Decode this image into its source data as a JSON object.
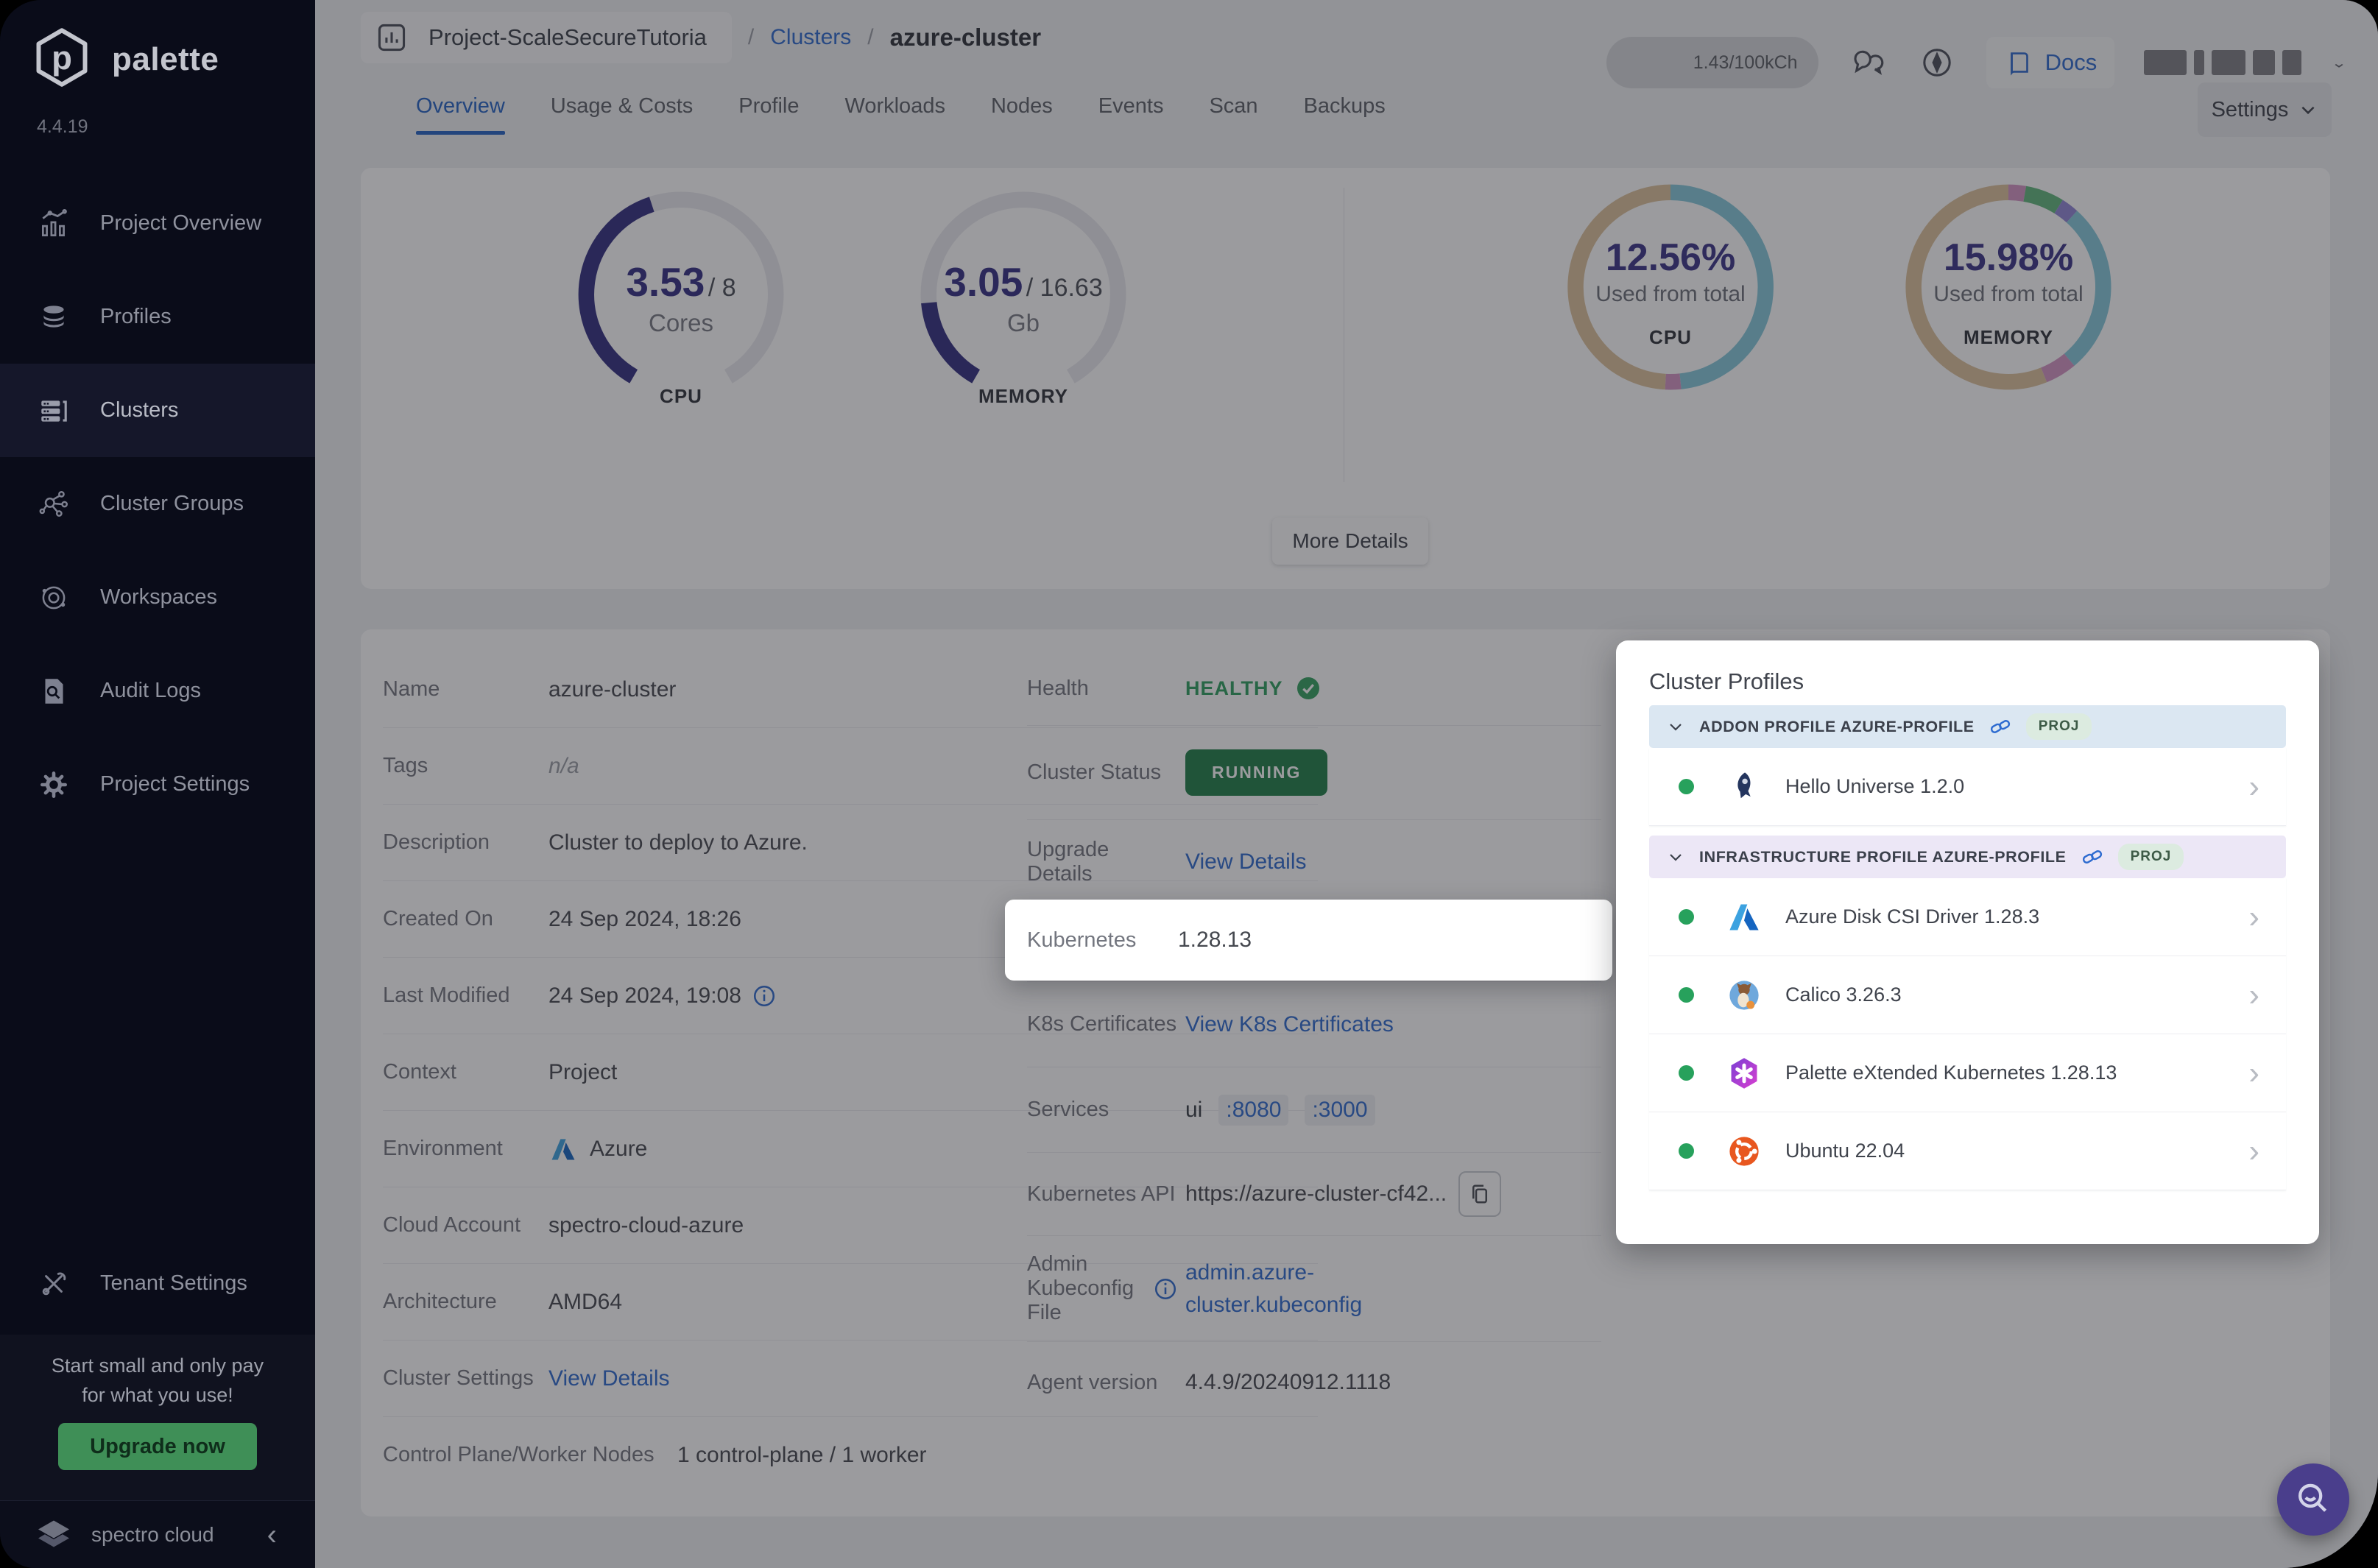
{
  "sidebar": {
    "brand": "palette",
    "version": "4.4.19",
    "items": [
      {
        "label": "Project Overview"
      },
      {
        "label": "Profiles"
      },
      {
        "label": "Clusters"
      },
      {
        "label": "Cluster Groups"
      },
      {
        "label": "Workspaces"
      },
      {
        "label": "Audit Logs"
      },
      {
        "label": "Project Settings"
      }
    ],
    "tenant_settings": "Tenant Settings",
    "banner": {
      "line1": "Start small and only pay",
      "line2": "for what you use!",
      "cta": "Upgrade now"
    },
    "footer": {
      "brand": "spectro cloud",
      "collapse_icon": "‹"
    }
  },
  "header": {
    "breadcrumb": {
      "project": "Project-ScaleSecureTutoria",
      "sep": "/",
      "section": "Clusters",
      "current": "azure-cluster"
    },
    "usage_pill": "1.43/100kCh",
    "docs": "Docs"
  },
  "tabs": {
    "items": [
      "Overview",
      "Usage & Costs",
      "Profile",
      "Workloads",
      "Nodes",
      "Events",
      "Scan",
      "Backups"
    ]
  },
  "settings_button": "Settings",
  "stats": {
    "cpu_gauge": {
      "value": "3.53",
      "sep": "/",
      "total": "8",
      "unit": "Cores",
      "caption": "CPU"
    },
    "memory_gauge": {
      "value": "3.05",
      "sep": "/",
      "total": "16.63",
      "unit": "Gb",
      "caption": "MEMORY"
    },
    "cpu_donut": {
      "pct": "12.56%",
      "label": "Used from total",
      "caption": "CPU"
    },
    "memory_donut": {
      "pct": "15.98%",
      "label": "Used from total",
      "caption": "MEMORY"
    },
    "more_details": "More Details"
  },
  "chart_data": [
    {
      "type": "gauge",
      "title": "CPU",
      "value": 3.53,
      "max": 8,
      "unit": "Cores"
    },
    {
      "type": "gauge",
      "title": "MEMORY",
      "value": 3.05,
      "max": 16.63,
      "unit": "Gb"
    },
    {
      "type": "donut",
      "title": "CPU",
      "value_pct": 12.56,
      "label": "Used from total",
      "segments": [
        {
          "name": "used",
          "pct": 48.3,
          "color": "#85c8da"
        },
        {
          "name": "other",
          "pct": 2.5,
          "color": "#d494c4"
        },
        {
          "name": "free",
          "pct": 49.2,
          "color": "#dcc19b"
        }
      ]
    },
    {
      "type": "donut",
      "title": "MEMORY",
      "value_pct": 15.98,
      "label": "Used from total",
      "segments": [
        {
          "name": "s1",
          "pct": 2.8,
          "color": "#d494c4"
        },
        {
          "name": "s2",
          "pct": 6.1,
          "color": "#62b77c"
        },
        {
          "name": "s3",
          "pct": 2.8,
          "color": "#9186d6"
        },
        {
          "name": "s4",
          "pct": 27.2,
          "color": "#85c8da"
        },
        {
          "name": "s5",
          "pct": 5.0,
          "color": "#d494c4"
        },
        {
          "name": "free",
          "pct": 56.1,
          "color": "#dcc19b"
        }
      ]
    }
  ],
  "details": {
    "name": {
      "label": "Name",
      "value": "azure-cluster"
    },
    "tags": {
      "label": "Tags",
      "value": "n/a"
    },
    "description": {
      "label": "Description",
      "value": "Cluster to deploy to Azure."
    },
    "created": {
      "label": "Created On",
      "value": "24 Sep 2024, 18:26"
    },
    "modified": {
      "label": "Last Modified",
      "value": "24 Sep 2024, 19:08"
    },
    "context": {
      "label": "Context",
      "value": "Project"
    },
    "environment": {
      "label": "Environment",
      "value": "Azure"
    },
    "cloud_account": {
      "label": "Cloud Account",
      "value": "spectro-cloud-azure"
    },
    "architecture": {
      "label": "Architecture",
      "value": "AMD64"
    },
    "cluster_settings": {
      "label": "Cluster Settings",
      "link": "View Details"
    },
    "nodes": {
      "label": "Control Plane/Worker Nodes",
      "value": "1 control-plane / 1 worker"
    },
    "health": {
      "label": "Health",
      "value": "HEALTHY"
    },
    "status": {
      "label": "Cluster Status",
      "value": "RUNNING"
    },
    "upgrade": {
      "label": "Upgrade Details",
      "link": "View Details"
    },
    "kubernetes": {
      "label": "Kubernetes",
      "value": "1.28.13"
    },
    "certs": {
      "label": "K8s Certificates",
      "link": "View K8s Certificates"
    },
    "services": {
      "label": "Services",
      "prefix": "ui",
      "ports": [
        ":8080",
        ":3000"
      ]
    },
    "api": {
      "label": "Kubernetes API",
      "value": "https://azure-cluster-cf42..."
    },
    "kubeconfig": {
      "label": "Admin Kubeconfig File",
      "link": "admin.azure-cluster.kubeconfig"
    },
    "agent": {
      "label": "Agent version",
      "value": "4.4.9/20240912.1118"
    }
  },
  "profiles": {
    "title": "Cluster Profiles",
    "addon": {
      "header": "ADDON PROFILE AZURE-PROFILE",
      "badge": "PROJ",
      "items": [
        {
          "name": "Hello Universe 1.2.0"
        }
      ]
    },
    "infra": {
      "header": "INFRASTRUCTURE PROFILE AZURE-PROFILE",
      "badge": "PROJ",
      "items": [
        {
          "name": "Azure Disk CSI Driver 1.28.3"
        },
        {
          "name": "Calico 3.26.3"
        },
        {
          "name": "Palette eXtended Kubernetes 1.28.13"
        },
        {
          "name": "Ubuntu 22.04"
        }
      ]
    }
  },
  "icons": {
    "chevron_right": "›",
    "collapse": "‹",
    "chevron_down": "⌄"
  }
}
